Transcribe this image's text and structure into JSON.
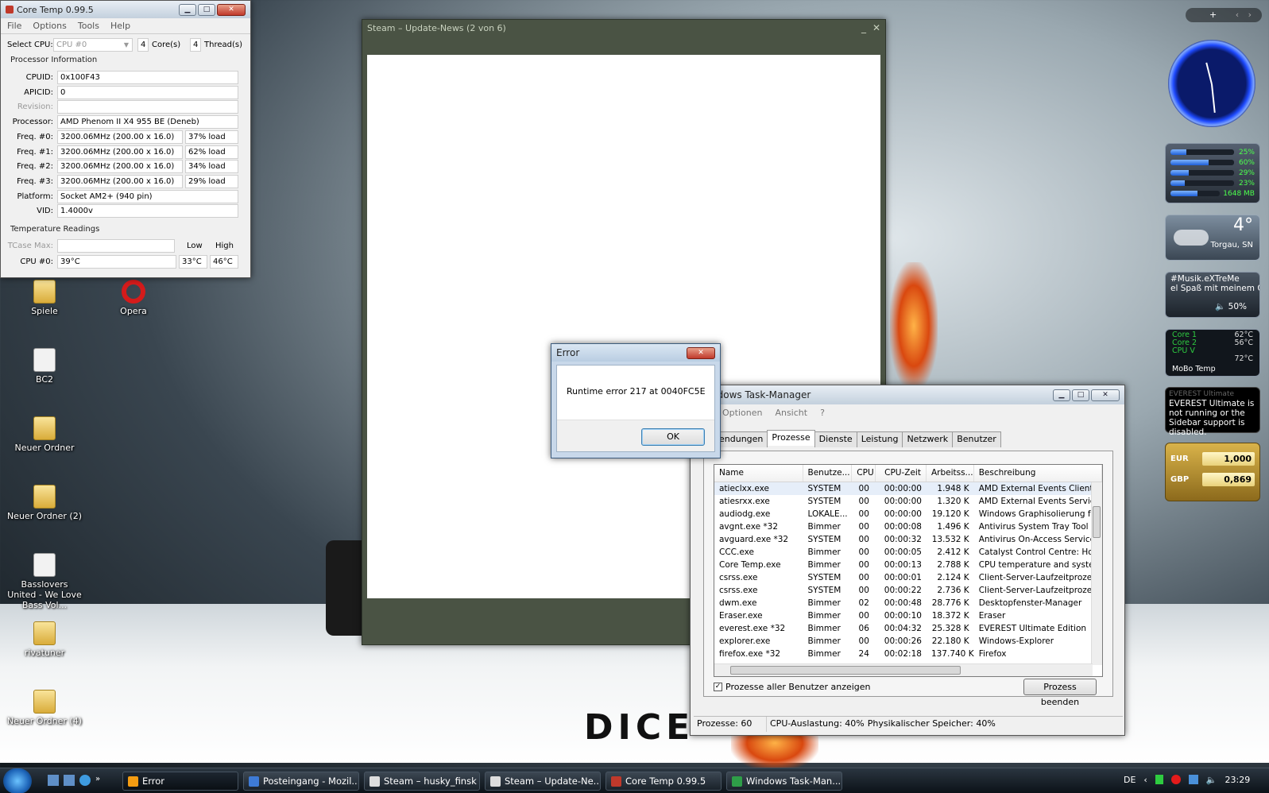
{
  "coretemp": {
    "title": "Core Temp 0.99.5",
    "menu": [
      "File",
      "Options",
      "Tools",
      "Help"
    ],
    "select_cpu_label": "Select CPU:",
    "cpu_select": "CPU #0",
    "cores_value": "4",
    "cores_label": "Core(s)",
    "threads_value": "4",
    "threads_label": "Thread(s)",
    "section_processor": "Processor Information",
    "rows": [
      {
        "label": "CPUID:",
        "value": "0x100F43"
      },
      {
        "label": "APICID:",
        "value": "0"
      },
      {
        "label": "Revision:",
        "value": ""
      },
      {
        "label": "Processor:",
        "value": "AMD Phenom II X4 955 BE (Deneb)"
      }
    ],
    "freqs": [
      {
        "label": "Freq. #0:",
        "value": "3200.06MHz (200.00 x 16.0)",
        "load": "37% load"
      },
      {
        "label": "Freq. #1:",
        "value": "3200.06MHz (200.00 x 16.0)",
        "load": "62% load"
      },
      {
        "label": "Freq. #2:",
        "value": "3200.06MHz (200.00 x 16.0)",
        "load": "34% load"
      },
      {
        "label": "Freq. #3:",
        "value": "3200.06MHz (200.00 x 16.0)",
        "load": "29% load"
      }
    ],
    "platform_label": "Platform:",
    "platform": "Socket AM2+ (940 pin)",
    "vid_label": "VID:",
    "vid": "1.4000v",
    "section_temp": "Temperature Readings",
    "tcase_label": "TCase Max:",
    "low_label": "Low",
    "high_label": "High",
    "cpu0_label": "CPU #0:",
    "cpu0_temp": "39°C",
    "cpu0_low": "33°C",
    "cpu0_high": "46°C"
  },
  "steam": {
    "title": "Steam – Update-News (2 von 6)"
  },
  "error": {
    "title": "Error",
    "message": "Runtime error 217 at 0040FC5E",
    "ok": "OK"
  },
  "taskmgr": {
    "title": "Windows Task-Manager",
    "title_visible": "ndows Task-Manager",
    "menu": [
      "Optionen",
      "Ansicht",
      "?"
    ],
    "tabs": [
      "endungen",
      "Prozesse",
      "Dienste",
      "Leistung",
      "Netzwerk",
      "Benutzer"
    ],
    "columns": [
      "Name",
      "Benutze...",
      "CPU",
      "CPU-Zeit",
      "Arbeitss...",
      "Beschreibung"
    ],
    "rows": [
      {
        "name": "atieclxx.exe",
        "user": "SYSTEM",
        "cpu": "00",
        "time": "00:00:00",
        "mem": "1.948 K",
        "desc": "AMD External Events Client M"
      },
      {
        "name": "atiesrxx.exe",
        "user": "SYSTEM",
        "cpu": "00",
        "time": "00:00:00",
        "mem": "1.320 K",
        "desc": "AMD External Events Service"
      },
      {
        "name": "audiodg.exe",
        "user": "LOKALE...",
        "cpu": "00",
        "time": "00:00:00",
        "mem": "19.120 K",
        "desc": "Windows Graphisolierung für ."
      },
      {
        "name": "avgnt.exe *32",
        "user": "Bimmer",
        "cpu": "00",
        "time": "00:00:08",
        "mem": "1.496 K",
        "desc": "Antivirus System Tray Tool"
      },
      {
        "name": "avguard.exe *32",
        "user": "SYSTEM",
        "cpu": "00",
        "time": "00:00:32",
        "mem": "13.532 K",
        "desc": "Antivirus On-Access Service"
      },
      {
        "name": "CCC.exe",
        "user": "Bimmer",
        "cpu": "00",
        "time": "00:00:05",
        "mem": "2.412 K",
        "desc": "Catalyst Control Centre: Host"
      },
      {
        "name": "Core Temp.exe",
        "user": "Bimmer",
        "cpu": "00",
        "time": "00:00:13",
        "mem": "2.788 K",
        "desc": "CPU temperature and system"
      },
      {
        "name": "csrss.exe",
        "user": "SYSTEM",
        "cpu": "00",
        "time": "00:00:01",
        "mem": "2.124 K",
        "desc": "Client-Server-Laufzeitprozess"
      },
      {
        "name": "csrss.exe",
        "user": "SYSTEM",
        "cpu": "00",
        "time": "00:00:22",
        "mem": "2.736 K",
        "desc": "Client-Server-Laufzeitprozess"
      },
      {
        "name": "dwm.exe",
        "user": "Bimmer",
        "cpu": "02",
        "time": "00:00:48",
        "mem": "28.776 K",
        "desc": "Desktopfenster-Manager"
      },
      {
        "name": "Eraser.exe",
        "user": "Bimmer",
        "cpu": "00",
        "time": "00:00:10",
        "mem": "18.372 K",
        "desc": "Eraser"
      },
      {
        "name": "everest.exe *32",
        "user": "Bimmer",
        "cpu": "06",
        "time": "00:04:32",
        "mem": "25.328 K",
        "desc": "EVEREST Ultimate Edition"
      },
      {
        "name": "explorer.exe",
        "user": "Bimmer",
        "cpu": "00",
        "time": "00:00:26",
        "mem": "22.180 K",
        "desc": "Windows-Explorer"
      },
      {
        "name": "firefox.exe *32",
        "user": "Bimmer",
        "cpu": "24",
        "time": "00:02:18",
        "mem": "137.740 K",
        "desc": "Firefox"
      }
    ],
    "show_all_label": "Prozesse aller Benutzer anzeigen",
    "end_process": "Prozess beenden",
    "status_processes": "Prozesse: 60",
    "status_cpu": "CPU-Auslastung: 40%",
    "status_mem": "Physikalischer Speicher: 40%"
  },
  "desktop_icons": [
    {
      "label": "Spiele",
      "type": "folder"
    },
    {
      "label": "Opera",
      "type": "opera"
    },
    {
      "label": "BC2",
      "type": "file"
    },
    {
      "label": "Neuer Ordner",
      "type": "folder"
    },
    {
      "label": "Neuer Ordner (2)",
      "type": "folder"
    },
    {
      "label": "Basslovers United - We Love Bass Vol...",
      "type": "mp3"
    },
    {
      "label": "rivatuner",
      "type": "folder"
    },
    {
      "label": "Neuer Ordner (4)",
      "type": "folder"
    }
  ],
  "desktop_brand": "DICE",
  "gadgets": {
    "cpu_bars": [
      "25%",
      "60%",
      "29%",
      "23%"
    ],
    "cpu_levels": [
      0.25,
      0.6,
      0.29,
      0.23
    ],
    "ram": "1648 MB",
    "ram_level": 0.55,
    "weather_temp": "4°",
    "weather_city": "Torgau, SN",
    "radio_title": "#Musik.eXTreMe",
    "radio_track": "el Spaß mit meinem Ga",
    "radio_volume": "50%",
    "temps": [
      {
        "label": "Core 1",
        "value": "62°C"
      },
      {
        "label": "Core 2",
        "value": "56°C"
      },
      {
        "label": "CPU V",
        "value": ""
      },
      {
        "label": "",
        "value": "72°C"
      }
    ],
    "mobo_label": "MoBo Temp",
    "everest_title": "EVEREST Ultimate",
    "everest_msg": "EVEREST Ultimate is not running or the Sidebar support is disabled.",
    "currency": [
      {
        "code": "EUR",
        "value": "1,000"
      },
      {
        "code": "GBP",
        "value": "0,869"
      }
    ]
  },
  "taskbar": {
    "buttons": [
      "Error",
      "Posteingang - Mozil...",
      "Steam – husky_finsk",
      "Steam – Update-Ne...",
      "Core Temp 0.99.5",
      "Windows Task-Man..."
    ],
    "lang": "DE",
    "clock": "23:29"
  },
  "colors": {
    "steam_frame": "#4a5344",
    "taskbar": "#1a222a",
    "gadget_blue": "#1e4aff"
  }
}
